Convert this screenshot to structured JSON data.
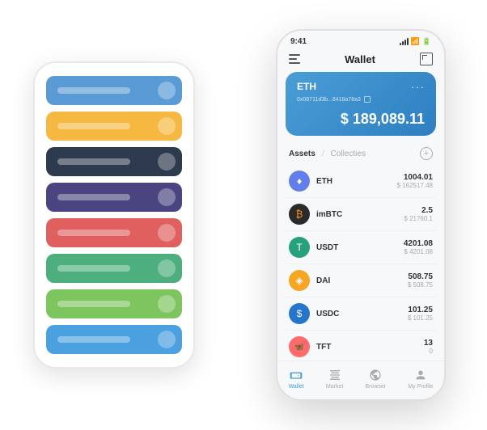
{
  "scene": {
    "back_phone": {
      "cards": [
        {
          "color": "card-blue",
          "id": "blue-card"
        },
        {
          "color": "card-yellow",
          "id": "yellow-card"
        },
        {
          "color": "card-dark",
          "id": "dark-card"
        },
        {
          "color": "card-purple",
          "id": "purple-card"
        },
        {
          "color": "card-red",
          "id": "red-card"
        },
        {
          "color": "card-green",
          "id": "green-card"
        },
        {
          "color": "card-light-green",
          "id": "light-green-card"
        },
        {
          "color": "card-sky",
          "id": "sky-card"
        }
      ]
    },
    "front_phone": {
      "status_bar": {
        "time": "9:41"
      },
      "header": {
        "title": "Wallet"
      },
      "eth_card": {
        "coin": "ETH",
        "address": "0x08711d3b...8418a78a3",
        "balance": "$ 189,089.11"
      },
      "tabs": {
        "active": "Assets",
        "inactive": "Collecties",
        "divider": "/"
      },
      "assets": [
        {
          "symbol": "ETH",
          "icon_label": "♦",
          "amount": "1004.01",
          "usd": "$ 162517.48",
          "icon_class": "eth-icon"
        },
        {
          "symbol": "imBTC",
          "icon_label": "₿",
          "amount": "2.5",
          "usd": "$ 21760.1",
          "icon_class": "imbtc-icon"
        },
        {
          "symbol": "USDT",
          "icon_label": "T",
          "amount": "4201.08",
          "usd": "$ 4201.08",
          "icon_class": "usdt-icon"
        },
        {
          "symbol": "DAI",
          "icon_label": "◈",
          "amount": "508.75",
          "usd": "$ 508.75",
          "icon_class": "dai-icon"
        },
        {
          "symbol": "USDC",
          "icon_label": "$",
          "amount": "101.25",
          "usd": "$ 101.25",
          "icon_class": "usdc-icon"
        },
        {
          "symbol": "TFT",
          "icon_label": "🦋",
          "amount": "13",
          "usd": "0",
          "icon_class": "tft-icon"
        }
      ],
      "bottom_nav": [
        {
          "label": "Wallet",
          "icon": "wallet",
          "active": true
        },
        {
          "label": "Market",
          "icon": "market",
          "active": false
        },
        {
          "label": "Browser",
          "icon": "browser",
          "active": false
        },
        {
          "label": "My Profile",
          "icon": "profile",
          "active": false
        }
      ]
    }
  }
}
